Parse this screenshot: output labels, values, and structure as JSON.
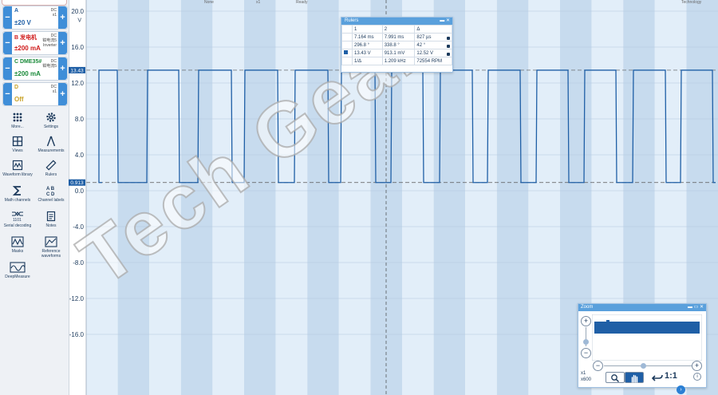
{
  "top_tabs": [
    "None",
    "x1",
    "Ready",
    "Technology"
  ],
  "channels": [
    {
      "letter": "A",
      "name": "A",
      "coupling": [
        "DC",
        "x1"
      ],
      "range": "±20 V",
      "color": "#1f5fa6"
    },
    {
      "letter": "B",
      "name": "B 发电机",
      "coupling": [
        "DC",
        "钳电流5",
        "Inverter"
      ],
      "range": "±200 mA",
      "color": "#d01b1b"
    },
    {
      "letter": "C",
      "name": "C DME35#",
      "coupling": [
        "DC",
        "钳电流5"
      ],
      "range": "±200 mA",
      "color": "#1a8a3a"
    },
    {
      "letter": "D",
      "name": "D",
      "coupling": [
        "DC",
        "x1"
      ],
      "range": "Off",
      "color": "#c9a227"
    }
  ],
  "tools": [
    {
      "id": "more",
      "label": "More...",
      "icon": "grid-dots-icon"
    },
    {
      "id": "settings",
      "label": "Settings",
      "icon": "gear-icon"
    },
    {
      "id": "views",
      "label": "Views",
      "icon": "views-grid-icon"
    },
    {
      "id": "measurements",
      "label": "Measurements",
      "icon": "caliper-icon"
    },
    {
      "id": "waveform-library",
      "label": "Waveform library",
      "icon": "library-icon"
    },
    {
      "id": "rulers",
      "label": "Rulers",
      "icon": "ruler-icon"
    },
    {
      "id": "math-channels",
      "label": "Math channels",
      "icon": "sigma-icon"
    },
    {
      "id": "channel-labels",
      "label": "Channel labels",
      "icon": "abcd-icon"
    },
    {
      "id": "serial-decoding",
      "label": "Serial decoding",
      "icon": "serial-icon"
    },
    {
      "id": "notes",
      "label": "Notes",
      "icon": "notes-icon"
    },
    {
      "id": "masks",
      "label": "Masks",
      "icon": "mask-icon"
    },
    {
      "id": "reference-waveforms",
      "label": "Reference waveforms",
      "icon": "reference-icon"
    },
    {
      "id": "deepmeasure",
      "label": "DeepMeasure",
      "icon": "deepmeasure-icon"
    }
  ],
  "axis": {
    "unit": "V",
    "ticks": [
      "20.0",
      "16.0",
      "12.0",
      "8.0",
      "4.0",
      "0.0",
      "-4.0",
      "-8.0",
      "-12.0",
      "-16.0"
    ],
    "ylim": [
      -20,
      20
    ],
    "high_marker": "13.43",
    "low_marker": "0.913"
  },
  "signal": {
    "high_v": 13.43,
    "low_v": 0.913,
    "color": "#1f5fa6"
  },
  "rulers": {
    "title": "Rulers",
    "header": [
      "1",
      "2",
      "Δ"
    ],
    "rows": [
      [
        "7.164 ms",
        "7.991 ms",
        "827 µs"
      ],
      [
        "296.8 °",
        "338.8 °",
        "42 °"
      ],
      [
        "13.43 V",
        "913.1 mV",
        "12.52 V"
      ]
    ],
    "freq_row": [
      "1/Δ",
      "1.209 kHz",
      "72554 RPM"
    ]
  },
  "zoom": {
    "title": "Zoom",
    "level": "x1",
    "multiplier": "x600",
    "one_to_one": "1:1",
    "info": "i"
  },
  "watermark": "Tech Gear"
}
